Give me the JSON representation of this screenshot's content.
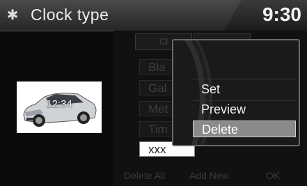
{
  "header": {
    "title": "Clock type",
    "time": "9:30",
    "settings_icon": "gear-icon"
  },
  "background": {
    "tab_label": "Cl",
    "items": [
      "Bla",
      "Gal",
      "Met",
      "Tim",
      "xxx"
    ],
    "bottom": [
      "Delete All",
      "Add New",
      "OK"
    ]
  },
  "thumbnail": {
    "time": "12:34"
  },
  "popup": {
    "options": [
      "Set",
      "Preview",
      "Delete"
    ],
    "selected": "Delete"
  }
}
